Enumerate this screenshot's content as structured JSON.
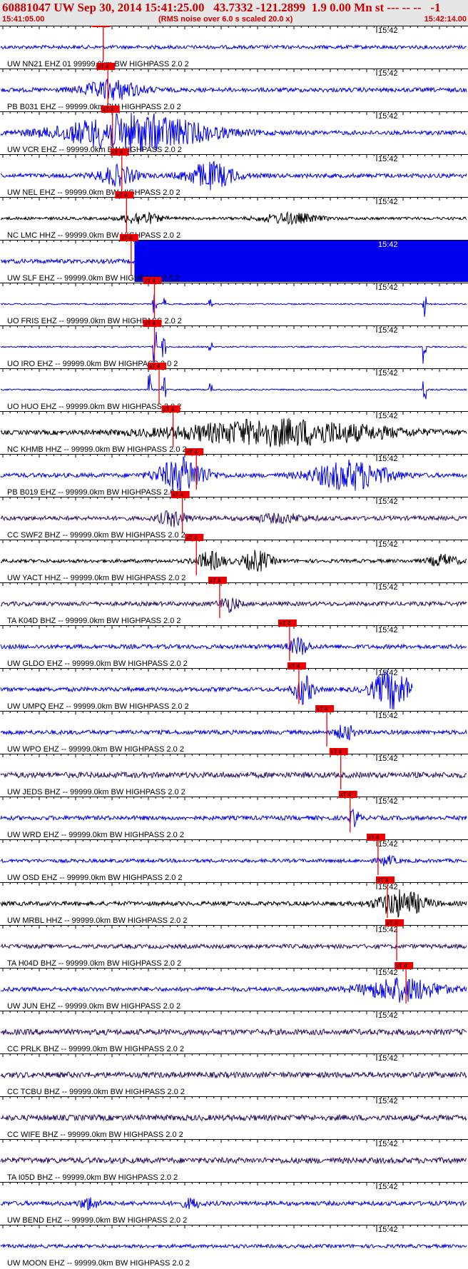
{
  "header": {
    "title": "60881047 UW Sep 30, 2014 15:41:25.00   43.7332 -121.2899  1.9 0.00 Mn st --- -- --   -1",
    "start_time": "15:41:05.00",
    "noise_note": "(RMS noise over 6.0 s scaled 20.0 x)",
    "end_time": "15:42:14.00"
  },
  "minute_label": "15:42",
  "pick_label": "xT 4",
  "colors": {
    "header_bg": "#e6e6e6",
    "header_text": "#cc0000",
    "pick": "#ee0000",
    "blue": "#0000ee",
    "black": "#000000",
    "purple": "#2a0c66"
  },
  "traces": [
    {
      "label": "UW NN21 EHZ 01 99999.0km BW  HIGHPASS  2.0  2",
      "color": "blue",
      "amp": 2.5,
      "pick": 0.22,
      "events": []
    },
    {
      "label": "PB B031 EHZ -- 99999.0km BW  HIGHPASS  2.0  2",
      "color": "blue",
      "amp": 3,
      "pick": 0.23,
      "events": [
        [
          0.24,
          13,
          0.06
        ]
      ]
    },
    {
      "label": "UW VCR EHZ -- 99999.0km BW  HIGHPASS  2.0  2",
      "color": "blue",
      "amp": 3,
      "pick": 0.24,
      "events": [
        [
          0.29,
          26,
          0.15
        ]
      ]
    },
    {
      "label": "UW NEL EHZ -- 99999.0km BW  HIGHPASS  2.0  2",
      "color": "blue",
      "amp": 3,
      "pick": 0.26,
      "events": [
        [
          0.25,
          13,
          0.04
        ],
        [
          0.45,
          18,
          0.05
        ]
      ]
    },
    {
      "label": "NC LMC HHZ -- 99999.0km BW  HIGHPASS  2.0  2",
      "color": "black",
      "amp": 2,
      "pick": 0.27,
      "events": [
        [
          0.3,
          8,
          0.04
        ],
        [
          0.62,
          7,
          0.06
        ]
      ]
    },
    {
      "label": "UW SLF EHZ -- 99999.0km BW  HIGHPASS  2.0  2",
      "color": "blue",
      "amp": 3,
      "pick": 0.28,
      "events": [],
      "saturated": 0.287
    },
    {
      "label": "UO FRIS EHZ -- 99999.0km BW  HIGHPASS  2.0  2",
      "color": "blue",
      "amp": 1,
      "pick": 0.33,
      "spikes": [
        [
          0.33,
          18
        ],
        [
          0.35,
          12
        ],
        [
          0.45,
          8
        ],
        [
          0.91,
          26
        ]
      ]
    },
    {
      "label": "UO IRO EHZ -- 99999.0km BW  HIGHPASS  2.0  2",
      "color": "blue",
      "amp": 1,
      "pick": 0.33,
      "spikes": [
        [
          0.33,
          22
        ],
        [
          0.35,
          16
        ],
        [
          0.45,
          8
        ],
        [
          0.91,
          30
        ]
      ]
    },
    {
      "label": "UO HUO EHZ -- 99999.0km BW  HIGHPASS  2.0  2",
      "color": "blue",
      "amp": 1,
      "pick": 0.34,
      "spikes": [
        [
          0.32,
          22
        ],
        [
          0.35,
          18
        ],
        [
          0.45,
          10
        ],
        [
          0.91,
          28
        ]
      ]
    },
    {
      "label": "NC KHMB HHZ -- 99999.0km BW  HIGHPASS  2.0  2",
      "color": "black",
      "amp": 3,
      "pick": 0.37,
      "events": [
        [
          0.6,
          18,
          0.22
        ]
      ]
    },
    {
      "label": "PB B019 EHZ -- 99999.0km BW  HIGHPASS  2.0  2",
      "color": "blue",
      "amp": 3,
      "pick": 0.42,
      "events": [
        [
          0.39,
          24,
          0.05
        ],
        [
          0.75,
          20,
          0.08
        ]
      ]
    },
    {
      "label": "CC SWF2 BHZ -- 99999.0km BW  HIGHPASS  2.0  2",
      "color": "purple",
      "amp": 3,
      "pick": 0.39,
      "events": [
        [
          0.37,
          10,
          0.03
        ],
        [
          0.6,
          5,
          0.06
        ]
      ]
    },
    {
      "label": "UW YACT HHZ -- 99999.0km BW  HIGHPASS  2.0  2",
      "color": "black",
      "amp": 2.5,
      "pick": 0.42,
      "events": [
        [
          0.45,
          12,
          0.03
        ],
        [
          0.55,
          14,
          0.03
        ],
        [
          0.95,
          8,
          0.03
        ]
      ]
    },
    {
      "label": "TA K04D BHZ -- 99999.0km BW  HIGHPASS  2.0  2",
      "color": "purple",
      "amp": 3,
      "pick": 0.47,
      "events": [
        [
          0.49,
          10,
          0.02
        ]
      ]
    },
    {
      "label": "UW GLDO EHZ -- 99999.0km BW  HIGHPASS  2.0  2",
      "color": "blue",
      "amp": 3,
      "pick": 0.62,
      "events": [
        [
          0.64,
          12,
          0.02
        ]
      ]
    },
    {
      "label": "UW UMPQ EHZ -- 99999.0km BW  HIGHPASS  2.0  2",
      "color": "blue",
      "amp": 3,
      "pick": 0.64,
      "events": [
        [
          0.65,
          20,
          0.02
        ],
        [
          0.84,
          28,
          0.04
        ]
      ],
      "end_fraction": 0.885
    },
    {
      "label": "UW WPO EHZ -- 99999.0km BW  HIGHPASS  2.0  2",
      "color": "blue",
      "amp": 3,
      "pick": 0.7,
      "events": [
        [
          0.74,
          10,
          0.02
        ]
      ]
    },
    {
      "label": "UW JEDS BHZ -- 99999.0km BW  HIGHPASS  2.0  2",
      "color": "purple",
      "amp": 4,
      "pick": 0.73,
      "events": []
    },
    {
      "label": "UW WRD EHZ -- 99999.0km BW  HIGHPASS  2.0  2",
      "color": "blue",
      "amp": 3,
      "pick": 0.75,
      "events": [
        [
          0.76,
          12,
          0.01
        ]
      ]
    },
    {
      "label": "UW OSD EHZ -- 99999.0km BW  HIGHPASS  2.0  2",
      "color": "blue",
      "amp": 2.5,
      "pick": 0.81,
      "events": [
        [
          0.83,
          6,
          0.02
        ]
      ]
    },
    {
      "label": "UW MRBL HHZ -- 99999.0km BW  HIGHPASS  2.0  2",
      "color": "black",
      "amp": 3,
      "pick": 0.83,
      "events": [
        [
          0.86,
          18,
          0.05
        ]
      ]
    },
    {
      "label": "TA H04D BHZ -- 99999.0km BW  HIGHPASS  2.0  2",
      "color": "purple",
      "amp": 3,
      "pick": 0.85,
      "events": []
    },
    {
      "label": "UW JUN EHZ -- 99999.0km BW  HIGHPASS  2.0  2",
      "color": "blue",
      "amp": 3,
      "pick": 0.87,
      "events": [
        [
          0.86,
          16,
          0.08
        ]
      ]
    },
    {
      "label": "CC PRLK BHZ -- 99999.0km BW  HIGHPASS  2.0  2",
      "color": "purple",
      "amp": 4,
      "events": []
    },
    {
      "label": "CC TCBU BHZ -- 99999.0km BW  HIGHPASS  2.0  2",
      "color": "purple",
      "amp": 4,
      "events": []
    },
    {
      "label": "CC WIFE BHZ -- 99999.0km BW  HIGHPASS  2.0  2",
      "color": "purple",
      "amp": 4,
      "events": []
    },
    {
      "label": "TA I05D BHZ -- 99999.0km BW  HIGHPASS  2.0  2",
      "color": "purple",
      "amp": 4,
      "events": []
    },
    {
      "label": "UW BEND EHZ -- 99999.0km BW  HIGHPASS  2.0  2",
      "color": "blue",
      "amp": 3,
      "events": [
        [
          0.19,
          8,
          0.02
        ],
        [
          0.41,
          6,
          0.02
        ]
      ]
    },
    {
      "label": "UW MOON EHZ -- 99999.0km BW  HIGHPASS  2.0  2",
      "color": "blue",
      "amp": 2.5,
      "events": []
    }
  ]
}
